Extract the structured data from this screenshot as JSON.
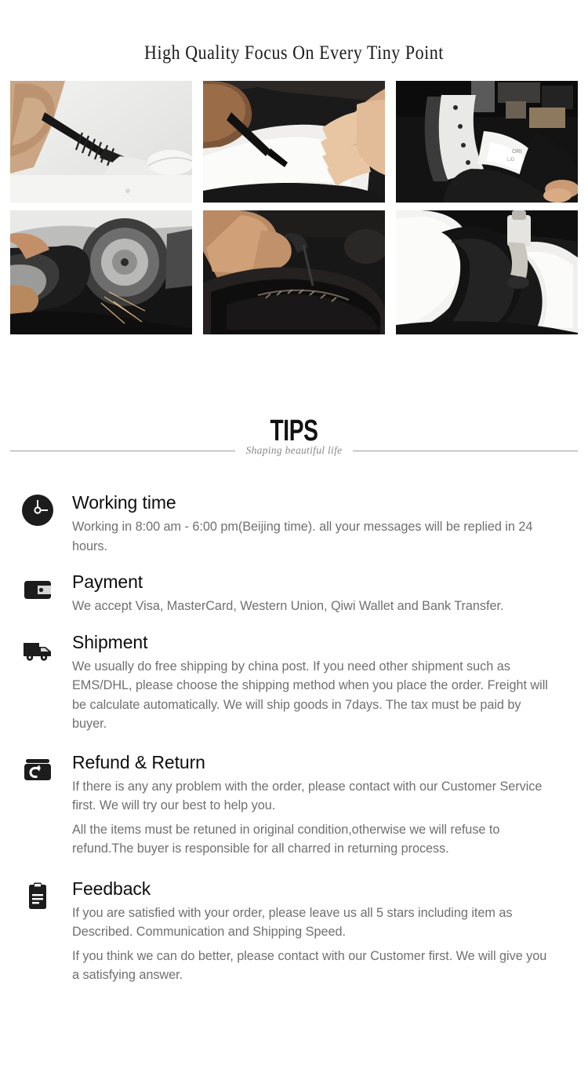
{
  "banner": {
    "title": "High Quality Focus On Every Tiny Point"
  },
  "gallery": {
    "images": [
      {
        "name": "craftsman-marking-pattern",
        "alt": "Hand marking a leather pattern with a pen"
      },
      {
        "name": "craftsman-cutting-leather",
        "alt": "Hands cutting black leather with a blade"
      },
      {
        "name": "leather-cutting-die-machine",
        "alt": "Metal cutting die pressing white leather"
      },
      {
        "name": "edge-grinding-machine",
        "alt": "Hand grinding a sole on a polishing machine"
      },
      {
        "name": "hand-stitching-shoe",
        "alt": "Hands stitching a black leather shoe"
      },
      {
        "name": "finishing-polishing-shoe",
        "alt": "Applying finish to a black and white shoe"
      }
    ]
  },
  "tips_header": {
    "word": "TIPS",
    "subtitle": "Shaping beautiful life"
  },
  "tips": [
    {
      "icon": "clock-icon",
      "title": "Working time",
      "paragraphs": [
        "Working in 8:00 am - 6:00 pm(Beijing time). all your messages will be replied in 24 hours."
      ]
    },
    {
      "icon": "wallet-icon",
      "title": "Payment",
      "paragraphs": [
        "We accept Visa, MasterCard, Western Union, Qiwi Wallet and Bank Transfer."
      ]
    },
    {
      "icon": "truck-icon",
      "title": "Shipment",
      "paragraphs": [
        "We usually do free shipping by china post. If you need other shipment such as EMS/DHL, please choose the shipping method when you place the order. Freight will be calculate automatically. We will ship goods in 7days. The tax must be paid by buyer."
      ]
    },
    {
      "icon": "return-box-icon",
      "title": "Refund & Return",
      "paragraphs": [
        "If there is any any problem with the order, please contact with our Customer Service first. We will try our best to help you.",
        "All the items must be retuned in original condition,otherwise we will refuse to refund.The buyer is responsible for all charred in returning process."
      ]
    },
    {
      "icon": "clipboard-icon",
      "title": "Feedback",
      "paragraphs": [
        "If you are satisfied with your order, please leave us all 5 stars including item as Described. Communication and Shipping Speed.",
        "If you think we can do better, please contact with our Customer first. We will give you a satisfying answer."
      ]
    }
  ],
  "colors": {
    "background": "#ffffff",
    "heading_text": "#0d0d0d",
    "body_text": "#6f7072",
    "rule": "#9b9b9b",
    "subtitle_text": "#8a8a8a",
    "icon_fill": "#1c1c1c"
  }
}
